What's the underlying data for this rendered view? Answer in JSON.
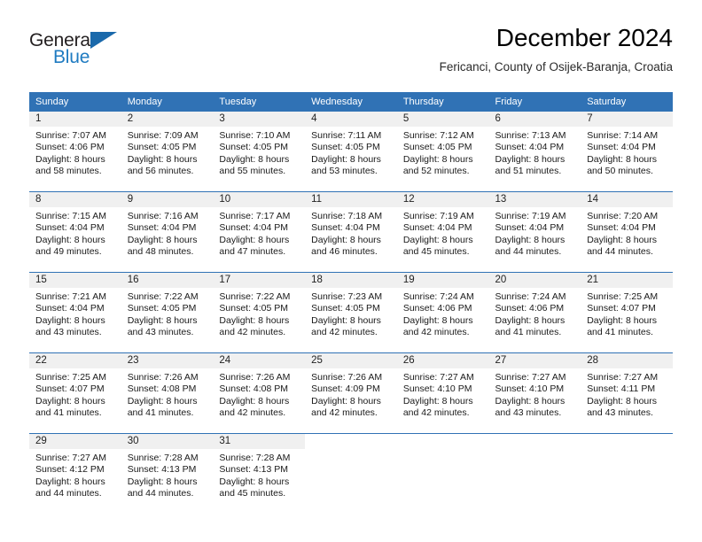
{
  "brand": {
    "name_part1": "General",
    "name_part2": "Blue",
    "triangle_icon": "triangle-icon",
    "color_dark": "#231f20",
    "color_blue": "#1f7bc1"
  },
  "header": {
    "title": "December 2024",
    "subtitle": "Fericanci, County of Osijek-Baranja, Croatia"
  },
  "theme": {
    "header_blue": "#3072b5",
    "daynum_band": "#f0f0f0",
    "text": "#1a1a1a"
  },
  "weekday_headers": [
    "Sunday",
    "Monday",
    "Tuesday",
    "Wednesday",
    "Thursday",
    "Friday",
    "Saturday"
  ],
  "weeks": [
    [
      {
        "day": "1",
        "sunrise": "Sunrise: 7:07 AM",
        "sunset": "Sunset: 4:06 PM",
        "daylight_1": "Daylight: 8 hours",
        "daylight_2": "and 58 minutes."
      },
      {
        "day": "2",
        "sunrise": "Sunrise: 7:09 AM",
        "sunset": "Sunset: 4:05 PM",
        "daylight_1": "Daylight: 8 hours",
        "daylight_2": "and 56 minutes."
      },
      {
        "day": "3",
        "sunrise": "Sunrise: 7:10 AM",
        "sunset": "Sunset: 4:05 PM",
        "daylight_1": "Daylight: 8 hours",
        "daylight_2": "and 55 minutes."
      },
      {
        "day": "4",
        "sunrise": "Sunrise: 7:11 AM",
        "sunset": "Sunset: 4:05 PM",
        "daylight_1": "Daylight: 8 hours",
        "daylight_2": "and 53 minutes."
      },
      {
        "day": "5",
        "sunrise": "Sunrise: 7:12 AM",
        "sunset": "Sunset: 4:05 PM",
        "daylight_1": "Daylight: 8 hours",
        "daylight_2": "and 52 minutes."
      },
      {
        "day": "6",
        "sunrise": "Sunrise: 7:13 AM",
        "sunset": "Sunset: 4:04 PM",
        "daylight_1": "Daylight: 8 hours",
        "daylight_2": "and 51 minutes."
      },
      {
        "day": "7",
        "sunrise": "Sunrise: 7:14 AM",
        "sunset": "Sunset: 4:04 PM",
        "daylight_1": "Daylight: 8 hours",
        "daylight_2": "and 50 minutes."
      }
    ],
    [
      {
        "day": "8",
        "sunrise": "Sunrise: 7:15 AM",
        "sunset": "Sunset: 4:04 PM",
        "daylight_1": "Daylight: 8 hours",
        "daylight_2": "and 49 minutes."
      },
      {
        "day": "9",
        "sunrise": "Sunrise: 7:16 AM",
        "sunset": "Sunset: 4:04 PM",
        "daylight_1": "Daylight: 8 hours",
        "daylight_2": "and 48 minutes."
      },
      {
        "day": "10",
        "sunrise": "Sunrise: 7:17 AM",
        "sunset": "Sunset: 4:04 PM",
        "daylight_1": "Daylight: 8 hours",
        "daylight_2": "and 47 minutes."
      },
      {
        "day": "11",
        "sunrise": "Sunrise: 7:18 AM",
        "sunset": "Sunset: 4:04 PM",
        "daylight_1": "Daylight: 8 hours",
        "daylight_2": "and 46 minutes."
      },
      {
        "day": "12",
        "sunrise": "Sunrise: 7:19 AM",
        "sunset": "Sunset: 4:04 PM",
        "daylight_1": "Daylight: 8 hours",
        "daylight_2": "and 45 minutes."
      },
      {
        "day": "13",
        "sunrise": "Sunrise: 7:19 AM",
        "sunset": "Sunset: 4:04 PM",
        "daylight_1": "Daylight: 8 hours",
        "daylight_2": "and 44 minutes."
      },
      {
        "day": "14",
        "sunrise": "Sunrise: 7:20 AM",
        "sunset": "Sunset: 4:04 PM",
        "daylight_1": "Daylight: 8 hours",
        "daylight_2": "and 44 minutes."
      }
    ],
    [
      {
        "day": "15",
        "sunrise": "Sunrise: 7:21 AM",
        "sunset": "Sunset: 4:04 PM",
        "daylight_1": "Daylight: 8 hours",
        "daylight_2": "and 43 minutes."
      },
      {
        "day": "16",
        "sunrise": "Sunrise: 7:22 AM",
        "sunset": "Sunset: 4:05 PM",
        "daylight_1": "Daylight: 8 hours",
        "daylight_2": "and 43 minutes."
      },
      {
        "day": "17",
        "sunrise": "Sunrise: 7:22 AM",
        "sunset": "Sunset: 4:05 PM",
        "daylight_1": "Daylight: 8 hours",
        "daylight_2": "and 42 minutes."
      },
      {
        "day": "18",
        "sunrise": "Sunrise: 7:23 AM",
        "sunset": "Sunset: 4:05 PM",
        "daylight_1": "Daylight: 8 hours",
        "daylight_2": "and 42 minutes."
      },
      {
        "day": "19",
        "sunrise": "Sunrise: 7:24 AM",
        "sunset": "Sunset: 4:06 PM",
        "daylight_1": "Daylight: 8 hours",
        "daylight_2": "and 42 minutes."
      },
      {
        "day": "20",
        "sunrise": "Sunrise: 7:24 AM",
        "sunset": "Sunset: 4:06 PM",
        "daylight_1": "Daylight: 8 hours",
        "daylight_2": "and 41 minutes."
      },
      {
        "day": "21",
        "sunrise": "Sunrise: 7:25 AM",
        "sunset": "Sunset: 4:07 PM",
        "daylight_1": "Daylight: 8 hours",
        "daylight_2": "and 41 minutes."
      }
    ],
    [
      {
        "day": "22",
        "sunrise": "Sunrise: 7:25 AM",
        "sunset": "Sunset: 4:07 PM",
        "daylight_1": "Daylight: 8 hours",
        "daylight_2": "and 41 minutes."
      },
      {
        "day": "23",
        "sunrise": "Sunrise: 7:26 AM",
        "sunset": "Sunset: 4:08 PM",
        "daylight_1": "Daylight: 8 hours",
        "daylight_2": "and 41 minutes."
      },
      {
        "day": "24",
        "sunrise": "Sunrise: 7:26 AM",
        "sunset": "Sunset: 4:08 PM",
        "daylight_1": "Daylight: 8 hours",
        "daylight_2": "and 42 minutes."
      },
      {
        "day": "25",
        "sunrise": "Sunrise: 7:26 AM",
        "sunset": "Sunset: 4:09 PM",
        "daylight_1": "Daylight: 8 hours",
        "daylight_2": "and 42 minutes."
      },
      {
        "day": "26",
        "sunrise": "Sunrise: 7:27 AM",
        "sunset": "Sunset: 4:10 PM",
        "daylight_1": "Daylight: 8 hours",
        "daylight_2": "and 42 minutes."
      },
      {
        "day": "27",
        "sunrise": "Sunrise: 7:27 AM",
        "sunset": "Sunset: 4:10 PM",
        "daylight_1": "Daylight: 8 hours",
        "daylight_2": "and 43 minutes."
      },
      {
        "day": "28",
        "sunrise": "Sunrise: 7:27 AM",
        "sunset": "Sunset: 4:11 PM",
        "daylight_1": "Daylight: 8 hours",
        "daylight_2": "and 43 minutes."
      }
    ],
    [
      {
        "day": "29",
        "sunrise": "Sunrise: 7:27 AM",
        "sunset": "Sunset: 4:12 PM",
        "daylight_1": "Daylight: 8 hours",
        "daylight_2": "and 44 minutes."
      },
      {
        "day": "30",
        "sunrise": "Sunrise: 7:28 AM",
        "sunset": "Sunset: 4:13 PM",
        "daylight_1": "Daylight: 8 hours",
        "daylight_2": "and 44 minutes."
      },
      {
        "day": "31",
        "sunrise": "Sunrise: 7:28 AM",
        "sunset": "Sunset: 4:13 PM",
        "daylight_1": "Daylight: 8 hours",
        "daylight_2": "and 45 minutes."
      },
      {
        "day": "",
        "sunrise": "",
        "sunset": "",
        "daylight_1": "",
        "daylight_2": ""
      },
      {
        "day": "",
        "sunrise": "",
        "sunset": "",
        "daylight_1": "",
        "daylight_2": ""
      },
      {
        "day": "",
        "sunrise": "",
        "sunset": "",
        "daylight_1": "",
        "daylight_2": ""
      },
      {
        "day": "",
        "sunrise": "",
        "sunset": "",
        "daylight_1": "",
        "daylight_2": ""
      }
    ]
  ]
}
